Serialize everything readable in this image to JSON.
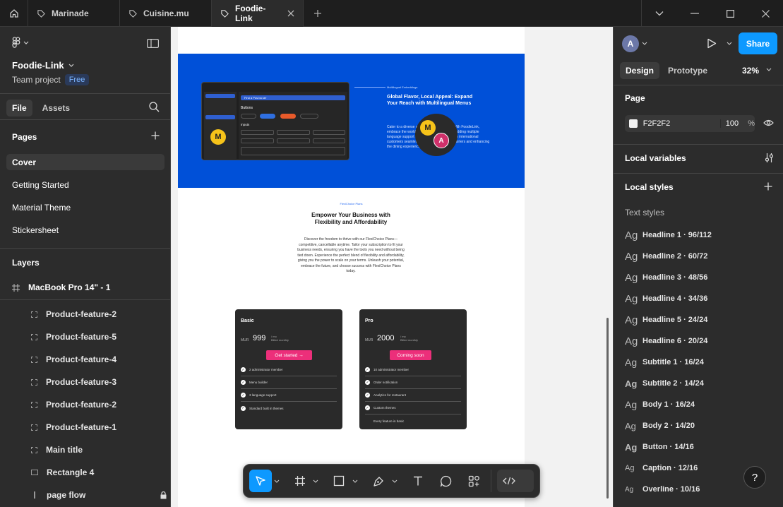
{
  "tabs": [
    {
      "label": "Marinade"
    },
    {
      "label": "Cuisine.mu"
    },
    {
      "label": "Foodie-Link"
    }
  ],
  "left_panel": {
    "project_name": "Foodie-Link",
    "team": "Team project",
    "plan_badge": "Free",
    "file_tab": "File",
    "assets_tab": "Assets",
    "pages_title": "Pages",
    "pages": [
      "Cover",
      "Getting Started",
      "Material Theme",
      "Stickersheet"
    ],
    "layers_title": "Layers",
    "root_layer": "MacBook Pro 14\" - 1",
    "layers": [
      "Product-feature-2",
      "Product-feature-5",
      "Product-feature-4",
      "Product-feature-3",
      "Product-feature-2",
      "Product-feature-1",
      "Main title",
      "Rectangle 4",
      "page flow"
    ]
  },
  "canvas": {
    "mock_search": "Find a Pos ba ser",
    "mock_section": "Buttons",
    "mock_inputs": "Inputs",
    "banner_tag": "Multilingual Embeddings",
    "banner_title": "Global Flavor, Local Appeal: Expand Your Reach with Multilingual Menus",
    "banner_body": "Cater to a diverse audience of food lovers With FoodieLink, embrace the world of cuisine by effortlessly adding multiple language support to your menu. Connect with international customers seamlessly, breaking language barriers and enhancing the dining experience for every guest.",
    "avatar_m": "M",
    "avatar_a": "A",
    "plans_tag": "FlexiChoice Plans",
    "plans_title": "Empower Your Business with Flexibility and Affordability",
    "plans_desc": "Discover the freedom to thrive with our FlexiChoice Plans—competitive, cancellable anytime. Tailor your subscription to fit your business needs, ensuring you have the tools you need without being tied down. Experience the perfect blend of flexibility and affordability, giving you the power to scale on your terms. Unleash your potential, embrace the future, and choose success with FlexiChoice Plans today.",
    "cards": [
      {
        "name": "Basic",
        "currency": "MUR",
        "price": "999",
        "per": "/ mo",
        "billed": "Billed monthly",
        "button": "Get started →",
        "features": [
          "2 administrator member",
          "Menu builder",
          "3 language support",
          "Standard built in themes"
        ]
      },
      {
        "name": "Pro",
        "currency": "MUR",
        "price": "2000",
        "per": "/ mo",
        "billed": "Billed monthly",
        "button": "Coming soon",
        "features": [
          "10 administrator member",
          "Order notification",
          "Analytics for restaurant",
          "Custom themes",
          "Every feature in basic"
        ]
      }
    ]
  },
  "right_panel": {
    "avatar": "A",
    "share": "Share",
    "design_tab": "Design",
    "prototype_tab": "Prototype",
    "zoom": "32%",
    "page_title": "Page",
    "page_color": "F2F2F2",
    "page_opacity": "100",
    "percent": "%",
    "local_variables": "Local variables",
    "local_styles": "Local styles",
    "text_styles_title": "Text styles",
    "text_styles": [
      {
        "ag": "Ag",
        "name": "Headline 1 · 96/112"
      },
      {
        "ag": "Ag",
        "name": "Headline 2 · 60/72"
      },
      {
        "ag": "Ag",
        "name": "Headline 3 · 48/56"
      },
      {
        "ag": "Ag",
        "name": "Headline 4 · 34/36"
      },
      {
        "ag": "Ag",
        "name": "Headline 5 · 24/24"
      },
      {
        "ag": "Ag",
        "name": "Headline 6 · 20/24"
      },
      {
        "ag": "Ag",
        "name": "Subtitle 1 · 16/24"
      },
      {
        "ag": "Ag",
        "name": "Subtitle 2 · 14/24"
      },
      {
        "ag": "Ag",
        "name": "Body 1 · 16/24"
      },
      {
        "ag": "Ag",
        "name": "Body 2 · 14/20"
      },
      {
        "ag": "Ag",
        "name": "Button · 14/16"
      },
      {
        "ag": "Ag",
        "name": "Caption · 12/16"
      },
      {
        "ag": "Ag",
        "name": "Overline · 10/16"
      }
    ],
    "help": "?"
  },
  "colors": {
    "accent": "#0d99ff",
    "banner": "#0050d8",
    "cta": "#ec2f7a"
  }
}
